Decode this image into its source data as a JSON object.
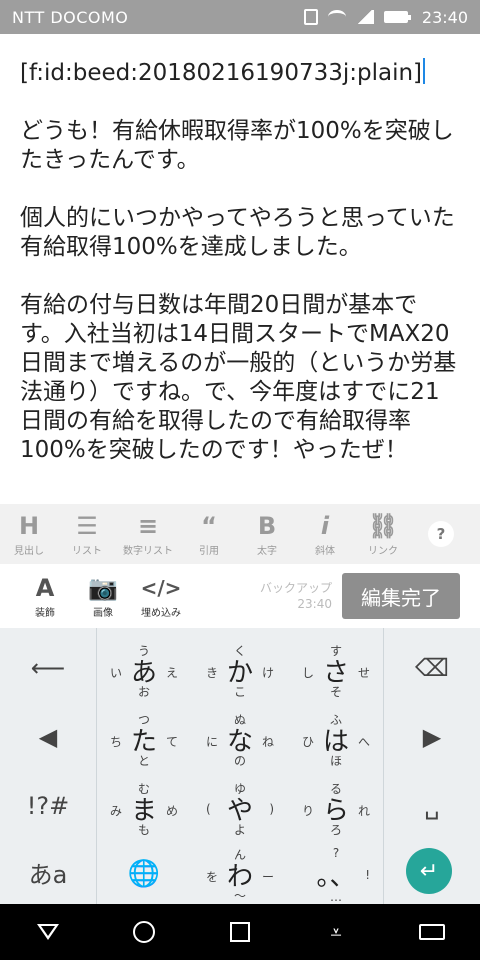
{
  "status": {
    "carrier": "NTT DOCOMO",
    "time": "23:40"
  },
  "editor": {
    "line1": "[f:id:beed:20180216190733j:plain]",
    "p1": "どうも！有給休暇取得率が100%を突破したきったんです。",
    "p2": "個人的にいつかやってやろうと思っていた有給取得100%を達成しました。",
    "p3": "有給の付与日数は年間20日間が基本です。入社当初は14日間スタートでMAX20日間まで増えるのが一般的（というか労基法通り）ですね。で、今年度はすでに21日間の有給を取得したので有給取得率100%を突破したのです！やったぜ！"
  },
  "toolbar": {
    "row1": [
      {
        "glyph": "H",
        "label": "見出し",
        "icon": "heading-icon"
      },
      {
        "glyph": "☰",
        "label": "リスト",
        "icon": "list-icon"
      },
      {
        "glyph": "≡",
        "label": "数字リスト",
        "icon": "numbered-list-icon"
      },
      {
        "glyph": "“",
        "label": "引用",
        "icon": "quote-icon"
      },
      {
        "glyph": "B",
        "label": "太字",
        "icon": "bold-icon"
      },
      {
        "glyph": "i",
        "label": "斜体",
        "icon": "italic-icon"
      },
      {
        "glyph": "⛓",
        "label": "リンク",
        "icon": "link-icon"
      }
    ],
    "help": "?",
    "row2": [
      {
        "glyph": "A",
        "label": "装飾",
        "icon": "decoration-icon"
      },
      {
        "glyph": "📷",
        "label": "画像",
        "icon": "camera-icon"
      },
      {
        "glyph": "</>",
        "label": "埋め込み",
        "icon": "embed-icon"
      }
    ],
    "backup_label": "バックアップ",
    "backup_time": "23:40",
    "done": "編集完了"
  },
  "keyboard": {
    "left": [
      "⟵",
      "◀",
      "!?#",
      "あa"
    ],
    "right": [
      "⌫",
      "▶",
      "␣",
      "↵"
    ],
    "keys": [
      {
        "main": "あ",
        "up": "う",
        "down": "お",
        "lt": "い",
        "rt": "え"
      },
      {
        "main": "か",
        "up": "く",
        "down": "こ",
        "lt": "き",
        "rt": "け"
      },
      {
        "main": "さ",
        "up": "す",
        "down": "そ",
        "lt": "し",
        "rt": "せ"
      },
      {
        "main": "た",
        "up": "つ",
        "down": "と",
        "lt": "ち",
        "rt": "て"
      },
      {
        "main": "な",
        "up": "ぬ",
        "down": "の",
        "lt": "に",
        "rt": "ね"
      },
      {
        "main": "は",
        "up": "ふ",
        "down": "ほ",
        "lt": "ひ",
        "rt": "へ"
      },
      {
        "main": "ま",
        "up": "む",
        "down": "も",
        "lt": "み",
        "rt": "め"
      },
      {
        "main": "や",
        "up": "ゆ",
        "down": "よ",
        "lt": "(",
        "rt": ")"
      },
      {
        "main": "ら",
        "up": "る",
        "down": "ろ",
        "lt": "り",
        "rt": "れ"
      },
      {
        "main": "🌐",
        "up": "",
        "down": "",
        "lt": "",
        "rt": ""
      },
      {
        "main": "わ",
        "up": "ん",
        "down": "〜",
        "lt": "を",
        "rt": "ー"
      },
      {
        "main": "。、",
        "up": "?",
        "down": "…",
        "lt": "",
        "rt": "!"
      }
    ]
  }
}
